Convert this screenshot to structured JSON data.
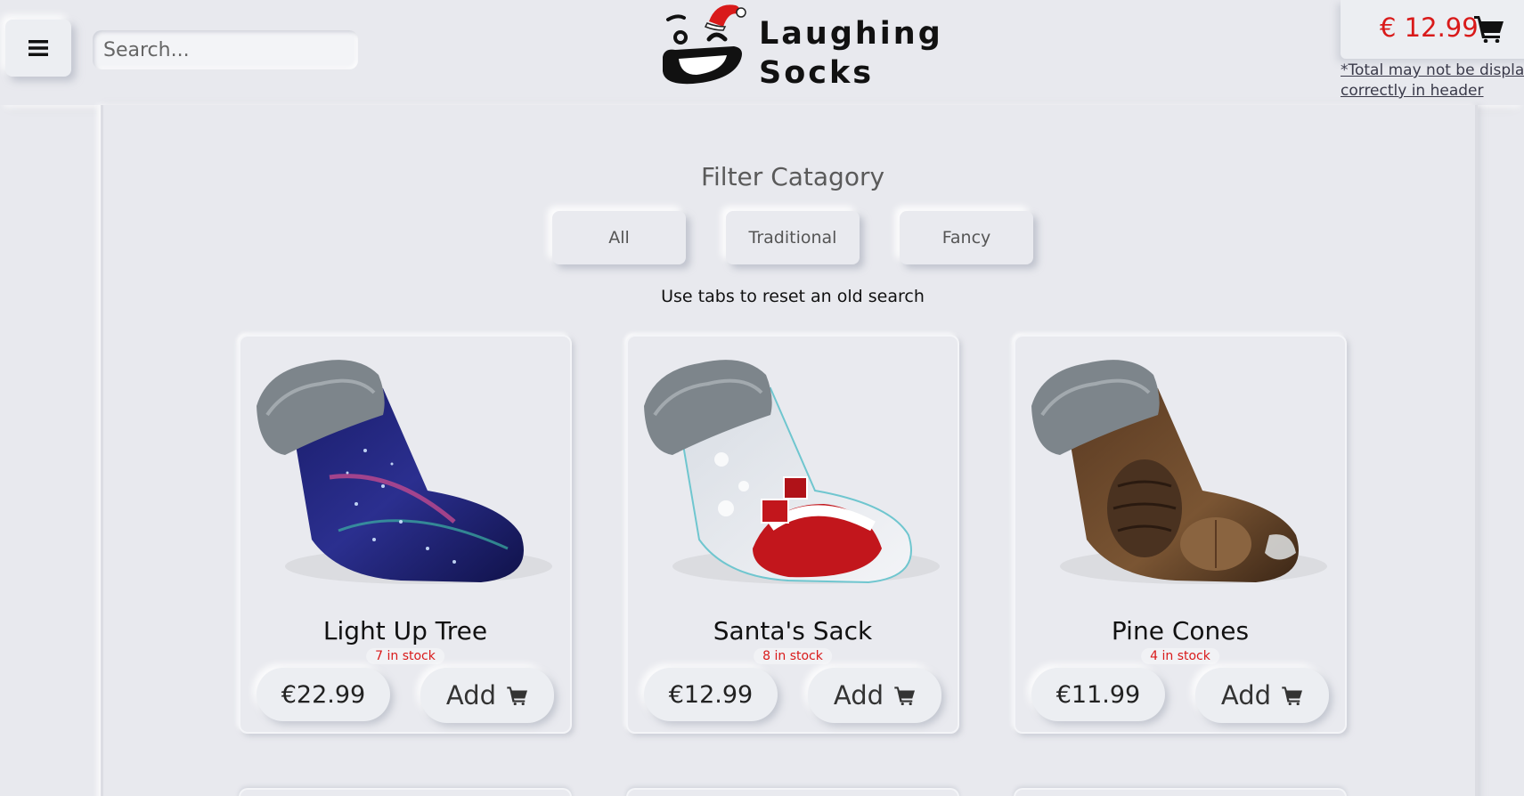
{
  "header": {
    "search_placeholder": "Search...",
    "logo_line1": "Laughing",
    "logo_line2": "Socks",
    "cart_total": "€ 12.99",
    "cart_note_line1": "*Total may not be displayed",
    "cart_note_line2": "correctly in header"
  },
  "filter": {
    "title": "Filter Catagory",
    "buttons": [
      "All",
      "Traditional",
      "Fancy"
    ],
    "hint": "Use tabs to reset an old search"
  },
  "products": [
    {
      "name": "Light Up Tree",
      "stock": "7 in stock",
      "price": "€22.99",
      "add_label": "Add"
    },
    {
      "name": "Santa's Sack",
      "stock": "8 in stock",
      "price": "€12.99",
      "add_label": "Add"
    },
    {
      "name": "Pine Cones",
      "stock": "4 in stock",
      "price": "€11.99",
      "add_label": "Add"
    }
  ],
  "colors": {
    "background": "#e8e9ee",
    "accent_red": "#d91a1a",
    "text_dark": "#1a1a1a"
  }
}
